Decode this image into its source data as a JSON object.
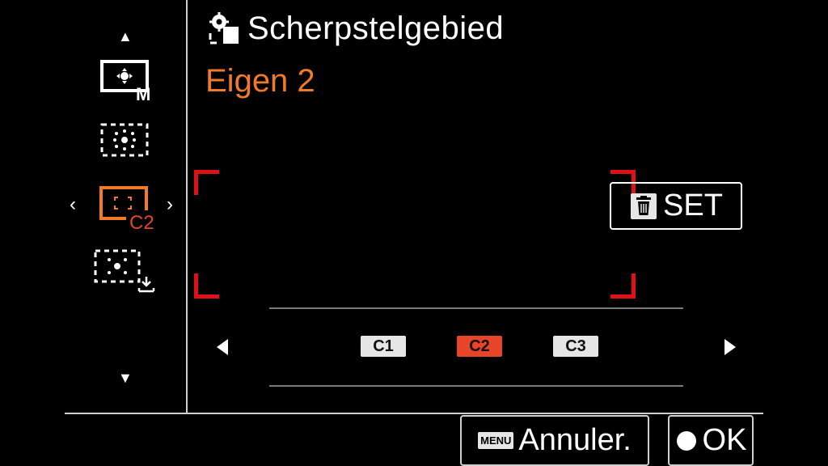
{
  "header": {
    "title": "Scherpstelgebied",
    "subtitle": "Eigen 2"
  },
  "sidebar": {
    "items": [
      {
        "name": "focus-area-flexible-spot-m",
        "badge": "M"
      },
      {
        "name": "focus-area-expand-flexible-spot",
        "badge": ""
      },
      {
        "name": "focus-area-custom",
        "badge": "C2",
        "selected": true
      },
      {
        "name": "focus-area-register",
        "badge": ""
      }
    ]
  },
  "set_button": {
    "label": "SET",
    "icon": "trash-icon"
  },
  "slots": {
    "items": [
      {
        "label": "C1",
        "selected": false
      },
      {
        "label": "C2",
        "selected": true
      },
      {
        "label": "C3",
        "selected": false
      }
    ]
  },
  "footer": {
    "menu_key": "MENU",
    "cancel_label": "Annuler.",
    "ok_label": "OK"
  },
  "colors": {
    "accent_orange": "#f07a28",
    "accent_red": "#e0101a",
    "chip_selected": "#e8442a"
  }
}
